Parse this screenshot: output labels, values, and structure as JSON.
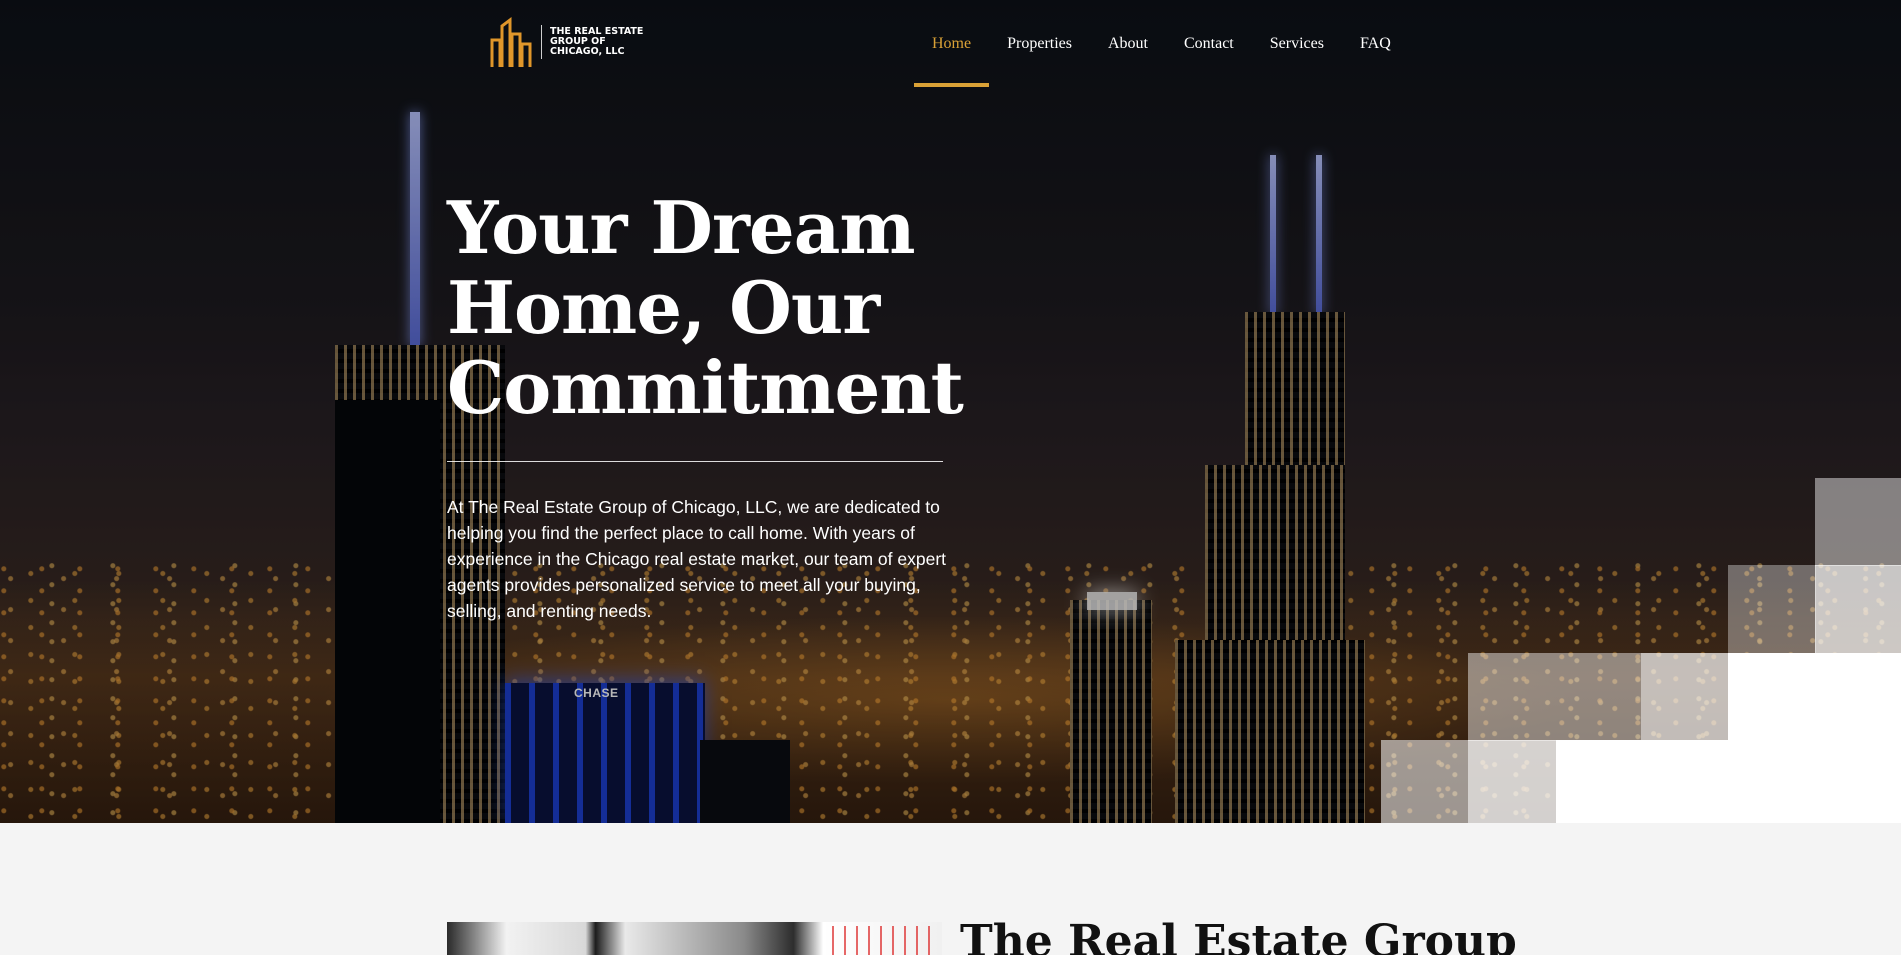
{
  "colors": {
    "accent": "#d9a136",
    "nav_text": "#ffffff",
    "section_bg": "#f4f4f4"
  },
  "logo": {
    "icon": "buildings-logo-icon",
    "text": "THE REAL ESTATE GROUP OF CHICAGO, LLC"
  },
  "nav": {
    "items": [
      {
        "label": "Home",
        "active": true
      },
      {
        "label": "Properties",
        "active": false
      },
      {
        "label": "About",
        "active": false
      },
      {
        "label": "Contact",
        "active": false
      },
      {
        "label": "Services",
        "active": false
      },
      {
        "label": "FAQ",
        "active": false
      }
    ]
  },
  "hero": {
    "title": "Your Dream Home, Our Commitment",
    "description": "At The Real Estate Group of Chicago, LLC, we are dedicated to helping you find the perfect place to call home. With years of experience in the Chicago real estate market, our team of expert agents provides personalized service to meet all your buying, selling, and renting needs.",
    "sign_text": "CHASE"
  },
  "about": {
    "heading": "The Real Estate Group"
  }
}
